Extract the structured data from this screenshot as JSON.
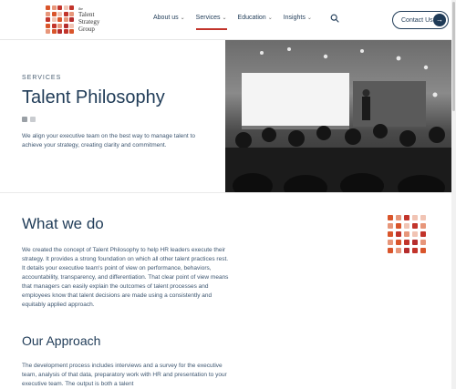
{
  "brand": {
    "the": "the",
    "line1": "Talent",
    "line2": "Strategy",
    "line3": "Group",
    "colors": [
      "#d9552b",
      "#c2342b",
      "#e7967a",
      "#f1c4b4",
      "#b52d2d"
    ]
  },
  "nav": {
    "items": [
      {
        "label": "About us"
      },
      {
        "label": "Services"
      },
      {
        "label": "Education"
      },
      {
        "label": "Insights"
      }
    ],
    "active_index": 1,
    "search_icon": "search-icon",
    "contact_label": "Contact Us",
    "contact_arrow": "→"
  },
  "hero": {
    "eyebrow": "SERVICES",
    "title": "Talent Philosophy",
    "description": "We align your executive team on the best way to manage talent to achieve your strategy, creating clarity and commitment."
  },
  "what_we_do": {
    "heading": "What we do",
    "paragraph": "We created the concept of Talent Philosophy to help HR leaders execute their strategy. It provides a strong foundation on which all other talent practices rest. It details your executive team's point of view on performance, behaviors, accountability, transparency, and differentiation. That clear point of view means that managers can easily explain the outcomes of talent processes and employees know that talent decisions are made using a consistently and equitably applied approach."
  },
  "approach": {
    "heading": "Our Approach",
    "paragraph": "The development process includes interviews and a survey for the executive team, analysis of that data, preparatory work with HR and presentation to your executive team. The output is both a talent"
  },
  "accent_colors": {
    "navy": "#1f3b57",
    "red": "#c2342b",
    "orange": "#d9552b"
  }
}
